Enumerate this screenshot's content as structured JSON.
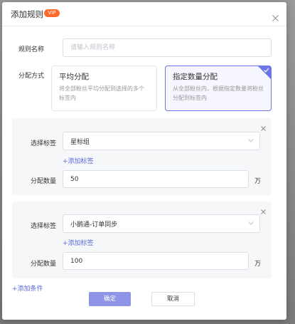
{
  "dialog": {
    "title": "添加规则",
    "vip_badge": "VIP"
  },
  "rule_name": {
    "label": "规则名称",
    "placeholder": "请输入规则名称"
  },
  "distribution": {
    "label": "分配方式",
    "options": [
      {
        "title": "平均分配",
        "desc": "将全部粉丝平均分配到选择的多个标签内",
        "selected": false
      },
      {
        "title": "指定数量分配",
        "desc": "从全部粉丝内，根据指定数量将粉丝分配到标签内",
        "selected": true
      }
    ]
  },
  "conditions": [
    {
      "tag_label": "选择标签",
      "tag_value": "星标组",
      "add_tag": "+添加标签",
      "count_label": "分配数量",
      "count_value": "50",
      "unit": "万"
    },
    {
      "tag_label": "选择标签",
      "tag_value": "小鹅通-订单同步",
      "add_tag": "+添加标签",
      "count_label": "分配数量",
      "count_value": "100",
      "unit": "万"
    }
  ],
  "add_condition": "+添加条件",
  "footer": {
    "confirm": "确定",
    "cancel": "取消"
  },
  "colors": {
    "accent": "#6c76e8",
    "link": "#5b6ae0",
    "primary_button": "#8e95e9",
    "badge": "#ff6a2a"
  }
}
